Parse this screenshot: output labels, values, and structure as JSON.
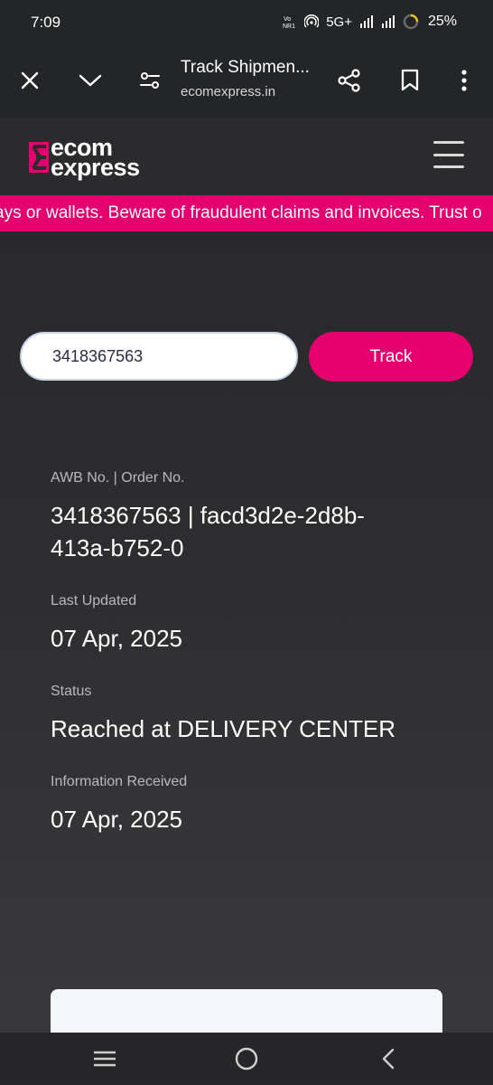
{
  "status_bar": {
    "time": "7:09",
    "network_label": "5G+",
    "battery_percent": "25%",
    "battery_level": 0.25
  },
  "browser": {
    "page_title": "Track Shipmen...",
    "domain": "ecomexpress.in",
    "icons": [
      "close-icon",
      "chevron-down-icon",
      "page-settings-icon",
      "share-icon",
      "bookmark-icon",
      "more-vertical-icon"
    ]
  },
  "site": {
    "logo_line1": "ecom",
    "logo_line2": "express",
    "brand_color": "#e4006e",
    "marquee_text": "ays or wallets. Beware of fraudulent claims and invoices. Trust o"
  },
  "search": {
    "value": "3418367563",
    "track_label": "Track"
  },
  "details": [
    {
      "label": "AWB No. | Order No.",
      "value": "3418367563 | facd3d2e-2d8b-413a-b752-0"
    },
    {
      "label": "Last Updated",
      "value": "07 Apr, 2025"
    },
    {
      "label": "Status",
      "value": "Reached at DELIVERY CENTER"
    },
    {
      "label": "Information Received",
      "value": "07 Apr, 2025"
    }
  ],
  "nav_bar": {
    "icons": [
      "recent-apps-icon",
      "home-icon",
      "back-icon"
    ]
  }
}
